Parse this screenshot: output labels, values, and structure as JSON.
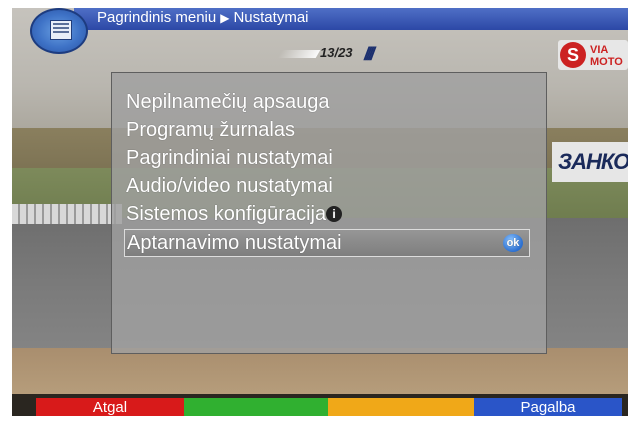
{
  "header": {
    "breadcrumb_root": "Pagrindinis meniu",
    "breadcrumb_current": "Nustatymai"
  },
  "overlay": {
    "lap_counter": "13/23",
    "billboard_text": "ЗАНКОС",
    "sponsor_text": "VIA MOTO"
  },
  "menu": {
    "items": [
      {
        "label": "Nepilnamečių apsauga"
      },
      {
        "label": "Programų žurnalas"
      },
      {
        "label": "Pagrindiniai nustatymai"
      },
      {
        "label": "Audio/video nustatymai"
      },
      {
        "label": "Sistemos konfigūracija"
      },
      {
        "label": "Aptarnavimo nustatymai"
      }
    ],
    "selected_index": 5,
    "ok_badge": "ok"
  },
  "color_keys": {
    "red": {
      "label": "Atgal",
      "color": "#d81a1a"
    },
    "green": {
      "label": "",
      "color": "#30b030"
    },
    "yellow": {
      "label": "",
      "color": "#f0a818"
    },
    "blue": {
      "label": "Pagalba",
      "color": "#2a55c8"
    }
  },
  "icons": {
    "menu": "menu-list-icon",
    "info": "info-icon",
    "ok": "ok-button-icon",
    "breadcrumb_separator": "triangle-right-icon"
  }
}
